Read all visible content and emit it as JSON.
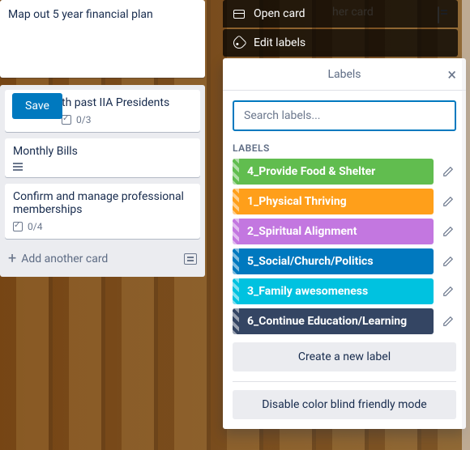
{
  "compose": {
    "text": "Map out 5 year financial plan",
    "save_label": "Save"
  },
  "cards": [
    {
      "title": "th past IIA Presidents",
      "checklist": "0/3"
    },
    {
      "title": "Monthly Bills"
    },
    {
      "title": "Confirm and manage professional memberships",
      "checklist": "0/4"
    }
  ],
  "list": {
    "add_card": "Add another card"
  },
  "context_menu": {
    "open_card": "Open card",
    "edit_labels": "Edit labels",
    "behind_text": "her card"
  },
  "labels_popover": {
    "title": "Labels",
    "search_placeholder": "Search labels...",
    "section": "LABELS",
    "items": [
      {
        "text": "4_Provide Food & Shelter",
        "color": "c-green"
      },
      {
        "text": "1_Physical Thriving",
        "color": "c-orange"
      },
      {
        "text": "2_Spiritual Alignment",
        "color": "c-purple"
      },
      {
        "text": "5_Social/Church/Politics",
        "color": "c-blue"
      },
      {
        "text": "3_Family awesomeness",
        "color": "c-teal"
      },
      {
        "text": "6_Continue Education/Learning",
        "color": "c-dark"
      }
    ],
    "create": "Create a new label",
    "colorblind": "Disable color blind friendly mode"
  }
}
